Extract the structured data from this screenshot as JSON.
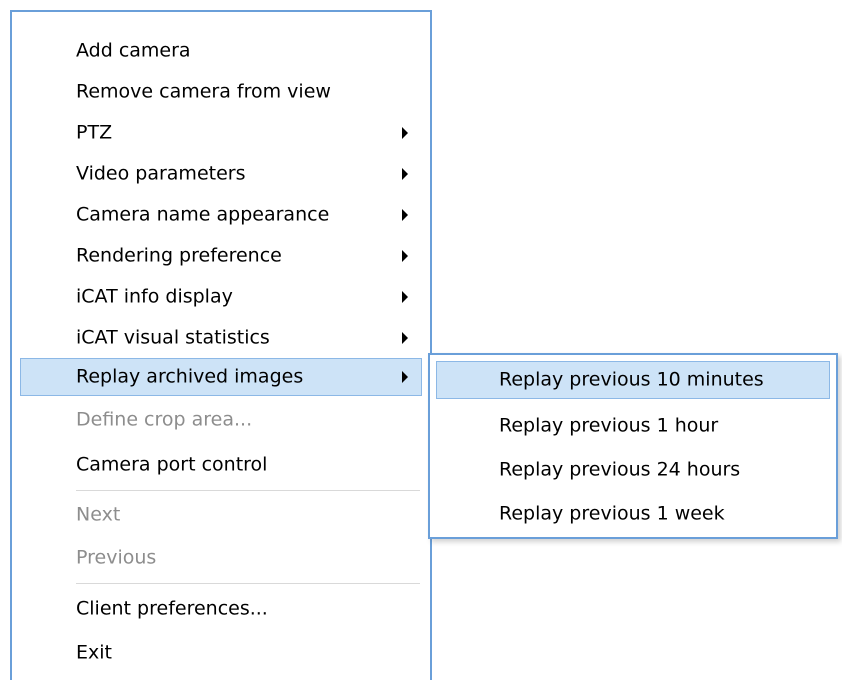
{
  "context_menu": {
    "items": [
      {
        "label": "Add camera",
        "enabled": true,
        "has_submenu": false
      },
      {
        "label": "Remove camera from view",
        "enabled": true,
        "has_submenu": false
      },
      {
        "label": "PTZ",
        "enabled": true,
        "has_submenu": true
      },
      {
        "label": "Video parameters",
        "enabled": true,
        "has_submenu": true
      },
      {
        "label": "Camera name appearance",
        "enabled": true,
        "has_submenu": true
      },
      {
        "label": "Rendering preference",
        "enabled": true,
        "has_submenu": true
      },
      {
        "label": "iCAT info display",
        "enabled": true,
        "has_submenu": true
      },
      {
        "label": "iCAT visual statistics",
        "enabled": true,
        "has_submenu": true
      },
      {
        "label": "Replay archived images",
        "enabled": true,
        "has_submenu": true,
        "highlighted": true
      },
      {
        "label": "Define crop area...",
        "enabled": false,
        "has_submenu": false
      },
      {
        "label": "Camera port control",
        "enabled": true,
        "has_submenu": false
      },
      {
        "label": "Next",
        "enabled": false,
        "has_submenu": false
      },
      {
        "label": "Previous",
        "enabled": false,
        "has_submenu": false
      },
      {
        "label": "Client preferences...",
        "enabled": true,
        "has_submenu": false
      },
      {
        "label": "Exit",
        "enabled": true,
        "has_submenu": false
      }
    ]
  },
  "replay_submenu": {
    "items": [
      {
        "label": "Replay previous 10 minutes",
        "highlighted": true
      },
      {
        "label": "Replay previous 1 hour"
      },
      {
        "label": "Replay previous 24 hours"
      },
      {
        "label": "Replay previous 1 week"
      }
    ]
  },
  "colors": {
    "menu_border": "#6a9fd9",
    "highlight_fill": "#cde3f7",
    "highlight_border": "#8cb8e6",
    "disabled_text": "#8d8d8d"
  }
}
